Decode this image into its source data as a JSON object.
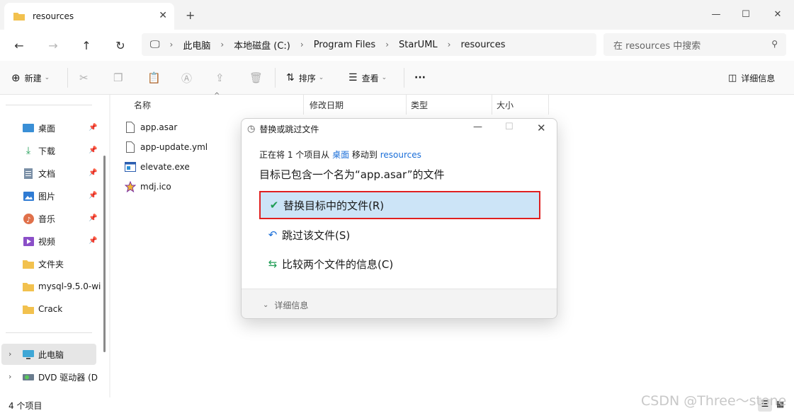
{
  "window": {
    "tab_title": "resources",
    "new_tab": "+",
    "close_tab": "✕"
  },
  "address": {
    "crumbs": [
      "此电脑",
      "本地磁盘 (C:)",
      "Program Files",
      "StarUML",
      "resources"
    ],
    "search_placeholder": "在 resources 中搜索"
  },
  "toolbar": {
    "new_label": "新建",
    "sort_label": "排序",
    "view_label": "查看",
    "more_label": "···",
    "details_label": "详细信息"
  },
  "sidebar": {
    "pinned": [
      {
        "label": "桌面"
      },
      {
        "label": "下载"
      },
      {
        "label": "文档"
      },
      {
        "label": "图片"
      },
      {
        "label": "音乐"
      },
      {
        "label": "视频"
      }
    ],
    "folders": [
      {
        "label": "文件夹"
      },
      {
        "label": "mysql-9.5.0-wi"
      },
      {
        "label": "Crack"
      }
    ],
    "this_pc": "此电脑",
    "dvd": "DVD 驱动器 (D"
  },
  "columns": {
    "name": "名称",
    "modified": "修改日期",
    "type": "类型",
    "size": "大小"
  },
  "files": [
    {
      "name": "app.asar"
    },
    {
      "name": "app-update.yml"
    },
    {
      "name": "elevate.exe"
    },
    {
      "name": "mdj.ico"
    }
  ],
  "status": {
    "count": "4 个项目"
  },
  "dialog": {
    "title": "替换或跳过文件",
    "sub_prefix": "正在将 1 个项目从 ",
    "sub_source": "桌面",
    "sub_middle": " 移动到 ",
    "sub_dest": "resources",
    "heading": "目标已包含一个名为“app.asar”的文件",
    "option_replace": "替换目标中的文件(R)",
    "option_skip": "跳过该文件(S)",
    "option_compare": "比较两个文件的信息(C)",
    "details": "详细信息"
  },
  "watermark": "CSDN @Three～stone",
  "colors": {
    "accent": "#1a6ed8",
    "selected_bg": "#cce4f7",
    "highlight_border": "#e02020",
    "folder": "#f2c14e"
  }
}
